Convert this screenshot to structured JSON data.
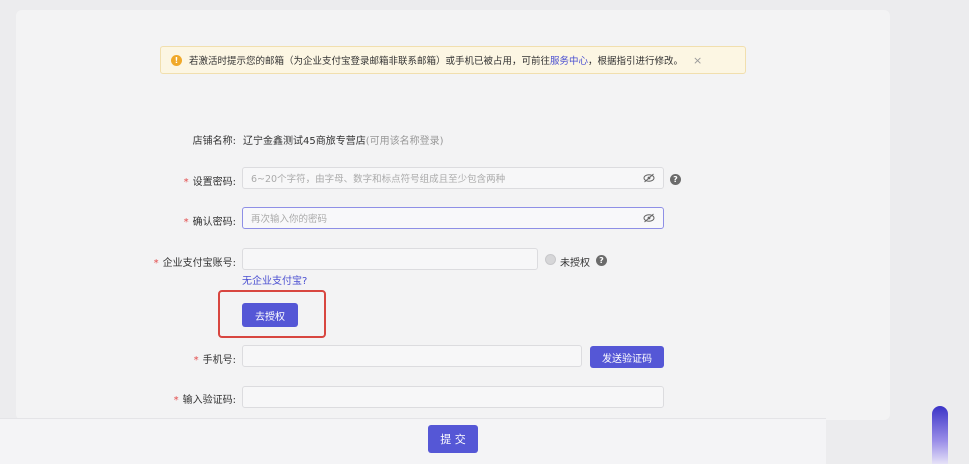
{
  "notice": {
    "text_before": "若激活时提示您的邮箱（为企业支付宝登录邮箱非联系邮箱）或手机已被占用，可前往",
    "link": "服务中心",
    "text_after": "，根据指引进行修改。",
    "close": "×"
  },
  "form": {
    "store_name_label": "店铺名称:",
    "store_name_value": "辽宁金鑫测试45商旅专营店",
    "store_name_hint": "(可用该名称登录)",
    "set_password_label": "设置密码:",
    "set_password_placeholder": "6~20个字符，由字母、数字和标点符号组成且至少包含两种",
    "confirm_password_label": "确认密码:",
    "confirm_password_placeholder": "再次输入你的密码",
    "alipay_label": "企业支付宝账号:",
    "alipay_value": "",
    "auth_status": "未授权",
    "no_alipay_link": "无企业支付宝?",
    "authorize_button": "去授权",
    "phone_label": "手机号:",
    "phone_value": "",
    "send_code_button": "发送验证码",
    "code_label": "输入验证码:",
    "code_value": "",
    "required_mark": "*",
    "help_mark": "?"
  },
  "footer": {
    "submit_button": "提 交"
  }
}
